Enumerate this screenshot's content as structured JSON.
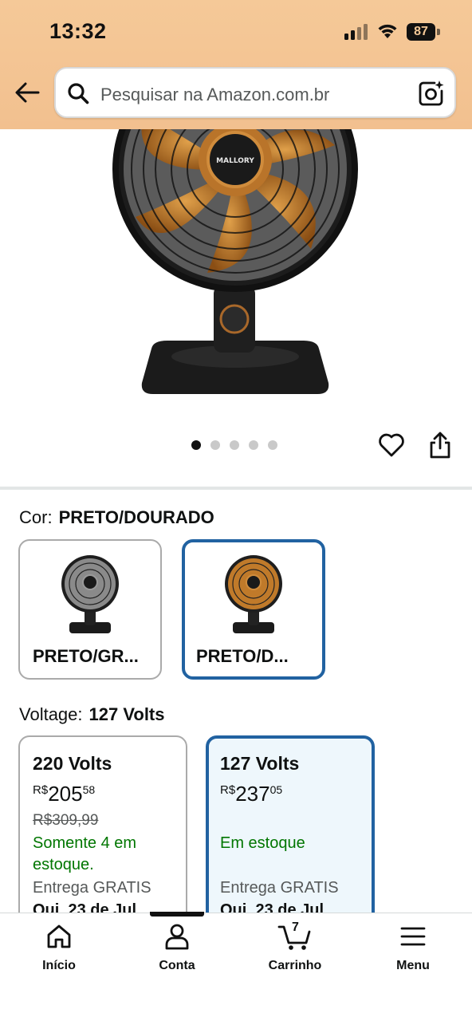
{
  "status_bar": {
    "time": "13:32",
    "battery": "87"
  },
  "search": {
    "placeholder": "Pesquisar na Amazon.com.br"
  },
  "gallery": {
    "dot_count": 5,
    "active_index": 0
  },
  "color": {
    "label": "Cor:",
    "selected_value": "PRETO/DOURADO",
    "options": [
      {
        "label": "PRETO/GR...",
        "blade_color": "#7a7a7a"
      },
      {
        "label": "PRETO/D...",
        "blade_color": "#c07a2a"
      }
    ]
  },
  "voltage": {
    "label": "Voltage:",
    "selected_value": "127 Volts",
    "options": [
      {
        "name": "220 Volts",
        "currency": "R$",
        "price_whole": "205",
        "price_cents": "58",
        "old_price": "R$309,99",
        "stock": "Somente 4 em estoque.",
        "shipping": "Entrega GRATIS",
        "date": "Qui, 23 de Jul"
      },
      {
        "name": "127 Volts",
        "currency": "R$",
        "price_whole": "237",
        "price_cents": "05",
        "old_price": "",
        "stock": "Em estoque",
        "shipping": "Entrega GRATIS",
        "date": "Qui, 23 de Jul"
      }
    ]
  },
  "bottom_nav": {
    "items": [
      {
        "label": "Início",
        "icon": "home-icon"
      },
      {
        "label": "Conta",
        "icon": "account-icon"
      },
      {
        "label": "Carrinho",
        "icon": "cart-icon",
        "count": "7"
      },
      {
        "label": "Menu",
        "icon": "menu-icon"
      }
    ]
  },
  "colors": {
    "header_bg": "#f3c596",
    "selected_border": "#2162a1",
    "in_stock": "#007600"
  }
}
